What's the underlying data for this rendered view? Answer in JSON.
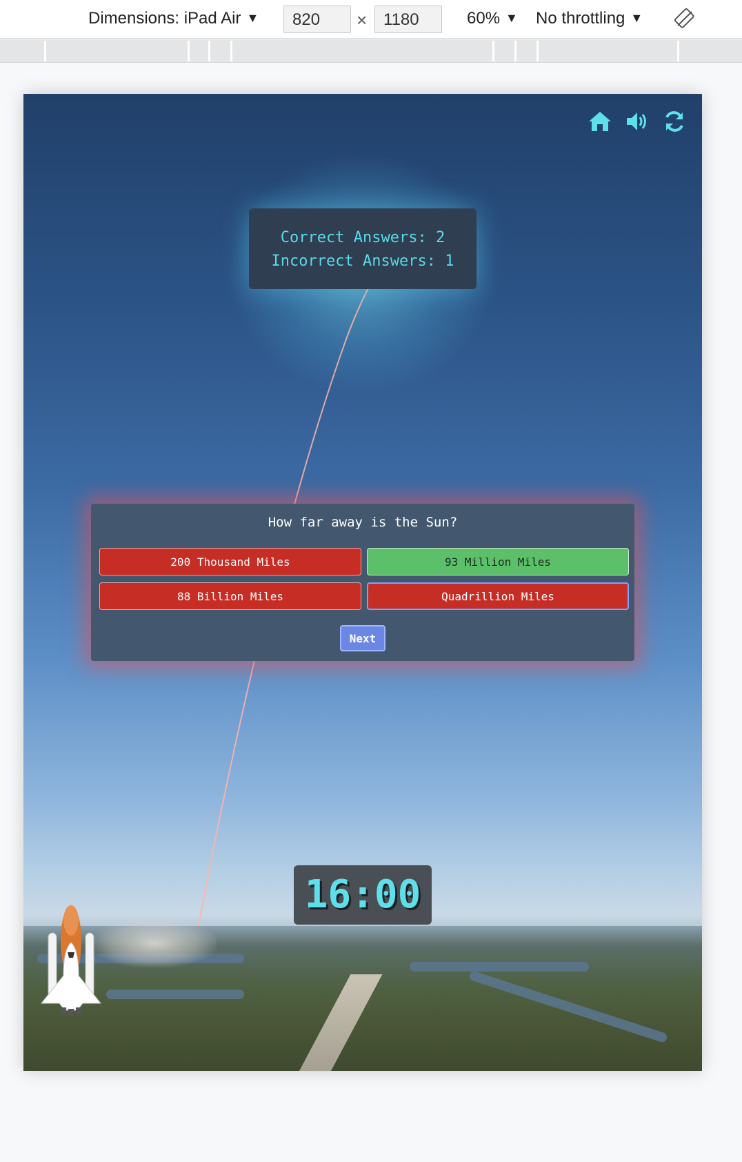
{
  "devtools": {
    "dimensions_label": "Dimensions: iPad Air",
    "width_value": "820",
    "times": "×",
    "height_value": "1180",
    "zoom": "60%",
    "throttling": "No throttling",
    "caret": "▼"
  },
  "controls": {
    "home_icon": "home-icon",
    "sound_icon": "volume-icon",
    "refresh_icon": "refresh-icon",
    "accent": "#5ee0ea"
  },
  "score": {
    "correct_line": "Correct Answers: 2",
    "incorrect_line": "Incorrect Answers: 1"
  },
  "quiz": {
    "question": "How far away is the Sun?",
    "answers": [
      {
        "label": "200 Thousand Miles",
        "state": "wrong"
      },
      {
        "label": "93 Million Miles",
        "state": "correct"
      },
      {
        "label": "88 Billion Miles",
        "state": "wrong"
      },
      {
        "label": "Quadrillion Miles",
        "state": "wrong-selected"
      }
    ],
    "next_label": "Next",
    "colors": {
      "wrong": "#c52d25",
      "correct": "#5cc06a",
      "next": "#6b87e6"
    }
  },
  "timer": {
    "value": "16:00"
  }
}
